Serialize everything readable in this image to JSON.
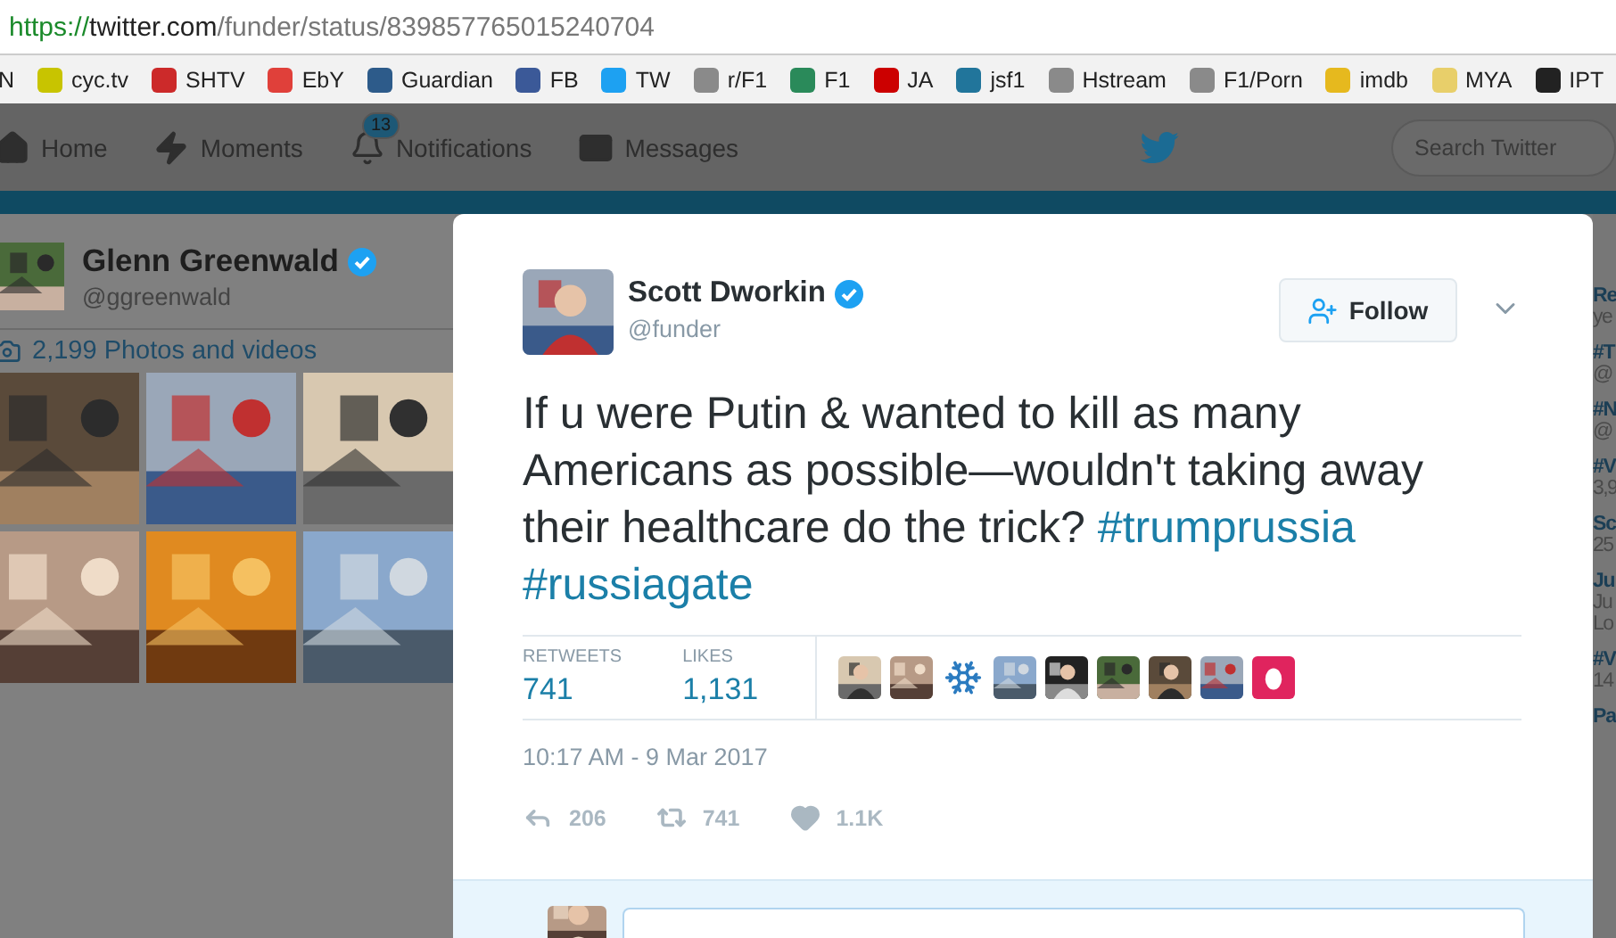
{
  "address_bar": {
    "scheme": "https://",
    "host": "twitter.com",
    "path": "/funder/status/839857765015240704"
  },
  "bookmarks": [
    {
      "kind": "text",
      "label": "N"
    },
    {
      "kind": "site",
      "label": "cyc.tv",
      "color": "#c8c400"
    },
    {
      "kind": "site",
      "label": "SHTV",
      "color": "#cc2a2a"
    },
    {
      "kind": "site",
      "label": "EbY",
      "color": "#e0403a"
    },
    {
      "kind": "site",
      "label": "Guardian",
      "color": "#2d5b8a"
    },
    {
      "kind": "site",
      "label": "FB",
      "color": "#3b5998"
    },
    {
      "kind": "site",
      "label": "TW",
      "color": "#1da1f2"
    },
    {
      "kind": "site",
      "label": "r/F1",
      "color": "#8a8a8a"
    },
    {
      "kind": "site",
      "label": "F1",
      "color": "#2a8a5a"
    },
    {
      "kind": "site",
      "label": "JA",
      "color": "#cc0000"
    },
    {
      "kind": "site",
      "label": "jsf1",
      "color": "#21759b"
    },
    {
      "kind": "site",
      "label": "Hstream",
      "color": "#8a8a8a"
    },
    {
      "kind": "site",
      "label": "F1/Porn",
      "color": "#8a8a8a"
    },
    {
      "kind": "site",
      "label": "imdb",
      "color": "#e6b91e"
    },
    {
      "kind": "site",
      "label": "MYA",
      "color": "#e8cf6a"
    },
    {
      "kind": "site",
      "label": "IPT",
      "color": "#222222"
    }
  ],
  "nav": {
    "items": [
      {
        "kind": "home",
        "label": "Home"
      },
      {
        "kind": "moments",
        "label": "Moments"
      },
      {
        "kind": "notifications",
        "label": "Notifications",
        "badge": "13"
      },
      {
        "kind": "messages",
        "label": "Messages"
      }
    ],
    "search_placeholder": "Search Twitter"
  },
  "profile_card": {
    "name": "Glenn Greenwald",
    "verified": true,
    "handle": "@ggreenwald",
    "media_count": "2,199 Photos and videos",
    "media": [
      {
        "kind": "picture"
      },
      {
        "kind": "picture"
      },
      {
        "kind": "picture"
      },
      {
        "kind": "picture"
      },
      {
        "kind": "picture"
      },
      {
        "kind": "picture"
      }
    ]
  },
  "trends": [
    {
      "title": "Re",
      "sub": "ye"
    },
    {
      "title": "#T",
      "sub": "@"
    },
    {
      "title": "#N",
      "sub": "@"
    },
    {
      "title": "#V",
      "sub": "3,9"
    },
    {
      "title": "Sc",
      "sub": "25"
    },
    {
      "title": "Ju",
      "sub": "Ju",
      "extra": "Lo"
    },
    {
      "title": "#V",
      "sub": "14"
    },
    {
      "title": "Pa"
    }
  ],
  "tweet": {
    "author": {
      "name": "Scott Dworkin",
      "verified": true,
      "handle": "@funder"
    },
    "follow_label": "Follow",
    "text": [
      {
        "kind": "text",
        "text": "If u were Putin & wanted to kill as many Americans as possible—wouldn't taking away their healthcare do the trick?"
      },
      {
        "kind": "hashtag",
        "text": "#trumprussia"
      },
      {
        "kind": "hashtag",
        "text": "#russiagate"
      }
    ],
    "stats": [
      {
        "label": "RETWEETS",
        "value": "741"
      },
      {
        "label": "LIKES",
        "value": "1,131"
      }
    ],
    "likers": [
      {
        "kind": "picture"
      },
      {
        "kind": "picture"
      },
      {
        "kind": "snowflake"
      },
      {
        "kind": "picture"
      },
      {
        "kind": "picture"
      },
      {
        "kind": "picture"
      },
      {
        "kind": "picture"
      },
      {
        "kind": "picture"
      },
      {
        "kind": "egg"
      }
    ],
    "timestamp": "10:17 AM - 9 Mar 2017",
    "actions": [
      {
        "kind": "reply",
        "count": "206"
      },
      {
        "kind": "retweet",
        "count": "741"
      },
      {
        "kind": "like",
        "count": "1.1K"
      }
    ]
  }
}
